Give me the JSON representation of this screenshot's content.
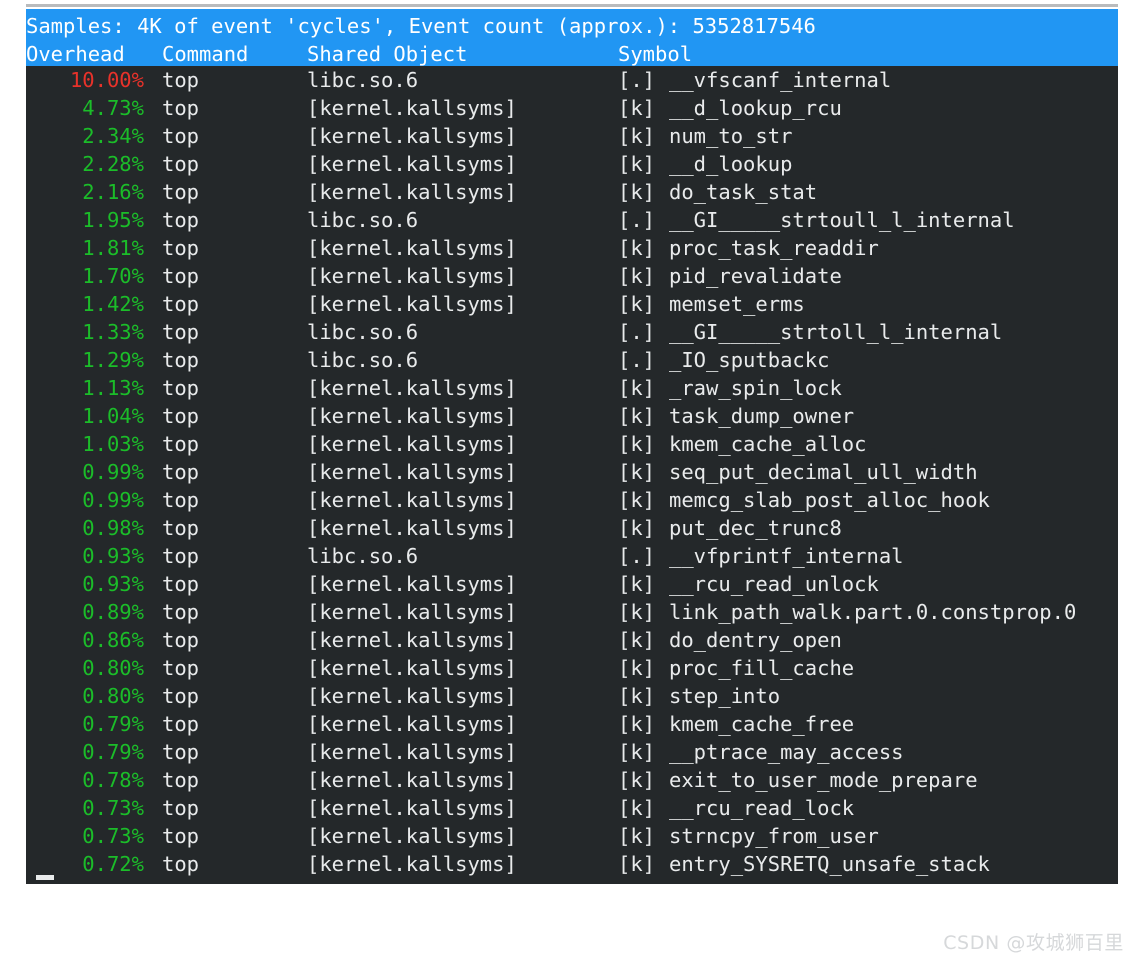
{
  "window": {
    "kind": "terminal",
    "program": "perf top",
    "background_color": "#24282a",
    "header_background_color": "#2196f3",
    "header_text_color": "#ffffff",
    "text_color": "#e9ebec",
    "hot_percent_color": "#e8322a",
    "warm_percent_color": "#1bbd29"
  },
  "header": {
    "summary": "Samples: 4K of event 'cycles', Event count (approx.): 5352817546",
    "samples_count": "4K",
    "event_name": "cycles",
    "event_count_approx": "5352817546",
    "columns": {
      "overhead": "Overhead",
      "command": "Command",
      "shared_object": "Shared Object",
      "symbol": "Symbol",
      "line": "Overhead  Command  Shared Object           Symbol"
    }
  },
  "rows": [
    {
      "overhead": "10.00%",
      "command": "top",
      "object": "libc.so.6",
      "dso": "[.]",
      "symbol": "__vfscanf_internal",
      "hot": true
    },
    {
      "overhead": "4.73%",
      "command": "top",
      "object": "[kernel.kallsyms]",
      "dso": "[k]",
      "symbol": "__d_lookup_rcu",
      "hot": false
    },
    {
      "overhead": "2.34%",
      "command": "top",
      "object": "[kernel.kallsyms]",
      "dso": "[k]",
      "symbol": "num_to_str",
      "hot": false
    },
    {
      "overhead": "2.28%",
      "command": "top",
      "object": "[kernel.kallsyms]",
      "dso": "[k]",
      "symbol": "__d_lookup",
      "hot": false
    },
    {
      "overhead": "2.16%",
      "command": "top",
      "object": "[kernel.kallsyms]",
      "dso": "[k]",
      "symbol": "do_task_stat",
      "hot": false
    },
    {
      "overhead": "1.95%",
      "command": "top",
      "object": "libc.so.6",
      "dso": "[.]",
      "symbol": "__GI_____strtoull_l_internal",
      "hot": false
    },
    {
      "overhead": "1.81%",
      "command": "top",
      "object": "[kernel.kallsyms]",
      "dso": "[k]",
      "symbol": "proc_task_readdir",
      "hot": false
    },
    {
      "overhead": "1.70%",
      "command": "top",
      "object": "[kernel.kallsyms]",
      "dso": "[k]",
      "symbol": "pid_revalidate",
      "hot": false
    },
    {
      "overhead": "1.42%",
      "command": "top",
      "object": "[kernel.kallsyms]",
      "dso": "[k]",
      "symbol": "memset_erms",
      "hot": false
    },
    {
      "overhead": "1.33%",
      "command": "top",
      "object": "libc.so.6",
      "dso": "[.]",
      "symbol": "__GI_____strtoll_l_internal",
      "hot": false
    },
    {
      "overhead": "1.29%",
      "command": "top",
      "object": "libc.so.6",
      "dso": "[.]",
      "symbol": "_IO_sputbackc",
      "hot": false
    },
    {
      "overhead": "1.13%",
      "command": "top",
      "object": "[kernel.kallsyms]",
      "dso": "[k]",
      "symbol": "_raw_spin_lock",
      "hot": false
    },
    {
      "overhead": "1.04%",
      "command": "top",
      "object": "[kernel.kallsyms]",
      "dso": "[k]",
      "symbol": "task_dump_owner",
      "hot": false
    },
    {
      "overhead": "1.03%",
      "command": "top",
      "object": "[kernel.kallsyms]",
      "dso": "[k]",
      "symbol": "kmem_cache_alloc",
      "hot": false
    },
    {
      "overhead": "0.99%",
      "command": "top",
      "object": "[kernel.kallsyms]",
      "dso": "[k]",
      "symbol": "seq_put_decimal_ull_width",
      "hot": false
    },
    {
      "overhead": "0.99%",
      "command": "top",
      "object": "[kernel.kallsyms]",
      "dso": "[k]",
      "symbol": "memcg_slab_post_alloc_hook",
      "hot": false
    },
    {
      "overhead": "0.98%",
      "command": "top",
      "object": "[kernel.kallsyms]",
      "dso": "[k]",
      "symbol": "put_dec_trunc8",
      "hot": false
    },
    {
      "overhead": "0.93%",
      "command": "top",
      "object": "libc.so.6",
      "dso": "[.]",
      "symbol": "__vfprintf_internal",
      "hot": false
    },
    {
      "overhead": "0.93%",
      "command": "top",
      "object": "[kernel.kallsyms]",
      "dso": "[k]",
      "symbol": "__rcu_read_unlock",
      "hot": false
    },
    {
      "overhead": "0.89%",
      "command": "top",
      "object": "[kernel.kallsyms]",
      "dso": "[k]",
      "symbol": "link_path_walk.part.0.constprop.0",
      "hot": false
    },
    {
      "overhead": "0.86%",
      "command": "top",
      "object": "[kernel.kallsyms]",
      "dso": "[k]",
      "symbol": "do_dentry_open",
      "hot": false
    },
    {
      "overhead": "0.80%",
      "command": "top",
      "object": "[kernel.kallsyms]",
      "dso": "[k]",
      "symbol": "proc_fill_cache",
      "hot": false
    },
    {
      "overhead": "0.80%",
      "command": "top",
      "object": "[kernel.kallsyms]",
      "dso": "[k]",
      "symbol": "step_into",
      "hot": false
    },
    {
      "overhead": "0.79%",
      "command": "top",
      "object": "[kernel.kallsyms]",
      "dso": "[k]",
      "symbol": "kmem_cache_free",
      "hot": false
    },
    {
      "overhead": "0.79%",
      "command": "top",
      "object": "[kernel.kallsyms]",
      "dso": "[k]",
      "symbol": "__ptrace_may_access",
      "hot": false
    },
    {
      "overhead": "0.78%",
      "command": "top",
      "object": "[kernel.kallsyms]",
      "dso": "[k]",
      "symbol": "exit_to_user_mode_prepare",
      "hot": false
    },
    {
      "overhead": "0.73%",
      "command": "top",
      "object": "[kernel.kallsyms]",
      "dso": "[k]",
      "symbol": "__rcu_read_lock",
      "hot": false
    },
    {
      "overhead": "0.73%",
      "command": "top",
      "object": "[kernel.kallsyms]",
      "dso": "[k]",
      "symbol": "strncpy_from_user",
      "hot": false
    },
    {
      "overhead": "0.72%",
      "command": "top",
      "object": "[kernel.kallsyms]",
      "dso": "[k]",
      "symbol": "entry_SYSRETQ_unsafe_stack",
      "hot": false
    }
  ],
  "watermark": {
    "text": "CSDN @攻城狮百里"
  }
}
